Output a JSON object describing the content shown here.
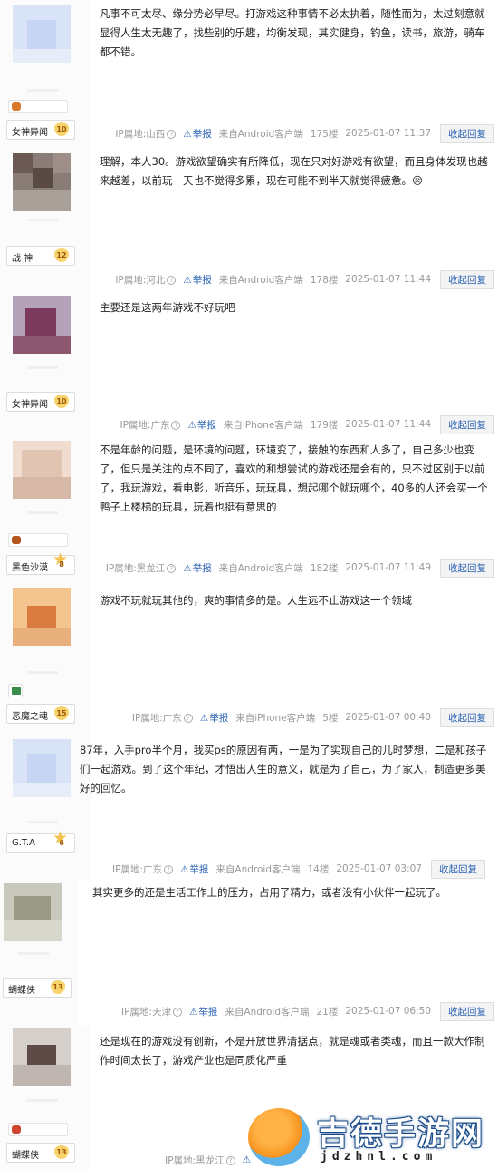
{
  "posts": [
    {
      "user": "女神异闻",
      "level": "10",
      "content": "凡事不可太尽、缘分势必早尽。打游戏这种事情不必太执着，随性而为，太过刻意就显得人生太无趣了，找些别的乐趣，均衡发现，其实健身，钓鱼，读书，旅游，骑车都不错。",
      "ip": "IP属地:山西",
      "report": "举报",
      "client": "来自Android客户端",
      "floor": "175楼",
      "time": "2025-01-07 11:37",
      "reply": "收起回复"
    },
    {
      "user": "战 神",
      "level": "12",
      "content": "理解，本人30。游戏欲望确实有所降低，现在只对好游戏有欲望，而且身体发现也越来越差，以前玩一天也不觉得多累，现在可能不到半天就觉得疲惫。😥",
      "ip": "IP属地:河北",
      "report": "举报",
      "client": "来自Android客户端",
      "floor": "178楼",
      "time": "2025-01-07 11:44",
      "reply": "收起回复"
    },
    {
      "user": "女神异闻",
      "level": "10",
      "content": "主要还是这两年游戏不好玩吧",
      "ip": "IP属地:广东",
      "report": "举报",
      "client": "来自iPhone客户端",
      "floor": "179楼",
      "time": "2025-01-07 11:44",
      "reply": "收起回复"
    },
    {
      "user": "黑色沙漠",
      "level": "8",
      "content": "不是年龄的问题，是环境的问题，环境变了，接触的东西和人多了，自己多少也变了，但只是关注的点不同了，喜欢的和想尝试的游戏还是会有的，只不过区别于以前了，我玩游戏，看电影，听音乐，玩玩具，想起哪个就玩哪个，40多的人还会买一个鸭子上楼梯的玩具，玩着也挺有意思的",
      "ip": "IP属地:黑龙江",
      "report": "举报",
      "client": "来自Android客户端",
      "floor": "182楼",
      "time": "2025-01-07 11:49",
      "reply": "收起回复"
    },
    {
      "user": "恶魔之魂",
      "level": "15",
      "content": "游戏不玩就玩其他的，爽的事情多的是。人生远不止游戏这一个领域",
      "ip": "IP属地:广东",
      "report": "举报",
      "client": "来自iPhone客户端",
      "floor": "5楼",
      "time": "2025-01-07 00:40",
      "reply": "收起回复"
    },
    {
      "user": "G.T.A",
      "level": "6",
      "content": "87年，入手pro半个月，我买ps的原因有两，一是为了实现自己的儿时梦想，二是和孩子们一起游戏。到了这个年纪，才悟出人生的意义，就是为了自己，为了家人，制造更多美好的回忆。",
      "ip": "IP属地:广东",
      "report": "举报",
      "client": "来自Android客户端",
      "floor": "14楼",
      "time": "2025-01-07 03:07",
      "reply": "收起回复"
    },
    {
      "user": "蝴蝶侠",
      "level": "13",
      "content": "其实更多的还是生活工作上的压力，占用了精力，或者没有小伙伴一起玩了。",
      "ip": "IP属地:天津",
      "report": "举报",
      "client": "来自Android客户端",
      "floor": "21楼",
      "time": "2025-01-07 06:50",
      "reply": "收起回复"
    },
    {
      "user": "蝴蝶侠",
      "level": "13",
      "content": "还是现在的游戏没有创新，不是开放世界清据点，就是魂或者类魂，而且一款大作制作时间太长了，游戏产业也是同质化严重",
      "ip": "IP属地:黑龙江",
      "report": "",
      "client": "",
      "floor": "",
      "time": "",
      "reply": ""
    }
  ],
  "watermark": {
    "title": "吉德手游网",
    "url": "jdzhnl.com"
  },
  "colors": {
    "accent": "#2d64b3",
    "meta_text": "#999999",
    "badge": "#f7d46b"
  }
}
